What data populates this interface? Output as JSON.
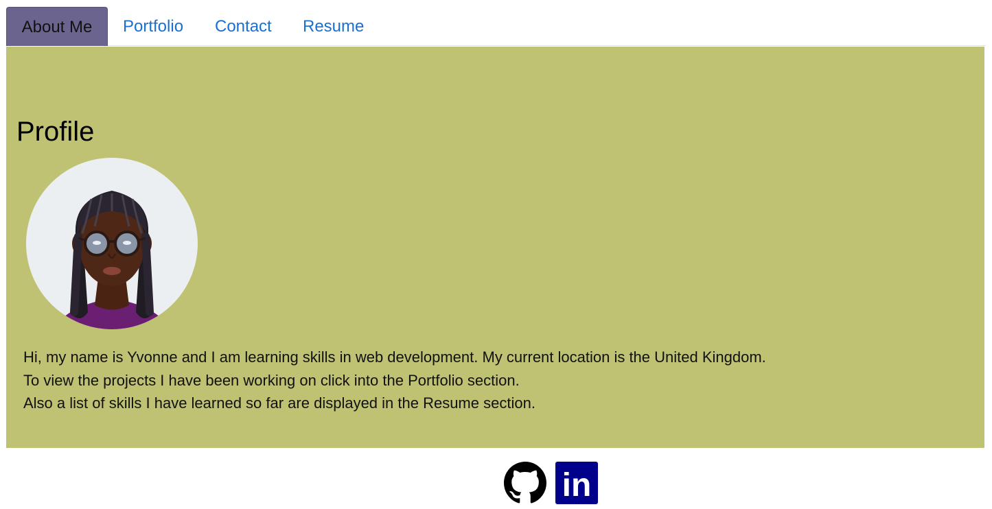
{
  "nav": {
    "tabs": [
      {
        "label": "About Me",
        "active": true
      },
      {
        "label": "Portfolio",
        "active": false
      },
      {
        "label": "Contact",
        "active": false
      },
      {
        "label": "Resume",
        "active": false
      }
    ]
  },
  "main": {
    "title": "Profile",
    "avatar_icon": "profile-avatar",
    "bio": [
      "Hi, my name is Yvonne and I am learning skills in web development. My current location is the United Kingdom.",
      "To view the projects I have been working on click into the Portfolio section.",
      "Also a list of skills I have learned so far are displayed in the Resume section."
    ]
  },
  "footer": {
    "links": [
      {
        "icon": "github-icon"
      },
      {
        "icon": "linkedin-icon",
        "text": "in"
      }
    ]
  },
  "colors": {
    "panel_bg": "#bfc173",
    "active_tab_bg": "#6a648f",
    "link": "#1a6fd1",
    "linkedin_bg": "#00008b"
  }
}
